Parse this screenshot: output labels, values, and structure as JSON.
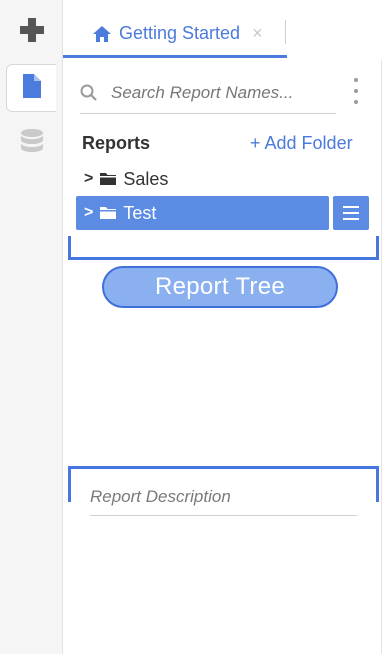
{
  "rail": {
    "icons": [
      "plus-icon",
      "report-document-icon",
      "database-icon"
    ]
  },
  "tab": {
    "label": "Getting Started",
    "close_glyph": "×",
    "home_icon": "home-icon"
  },
  "search": {
    "placeholder": "Search Report Names..."
  },
  "reports": {
    "title": "Reports",
    "add_folder_label": "+ Add Folder",
    "folders": [
      {
        "label": "Sales",
        "selected": false
      },
      {
        "label": "Test",
        "selected": true
      }
    ]
  },
  "annotations": {
    "report_tree_label": "Report Tree"
  },
  "description": {
    "placeholder": "Report Description"
  },
  "colors": {
    "accent": "#4b7bdc",
    "selected_row": "#5b8be3",
    "callout_fill": "#8ab0f0",
    "bracket": "#4677e0"
  }
}
